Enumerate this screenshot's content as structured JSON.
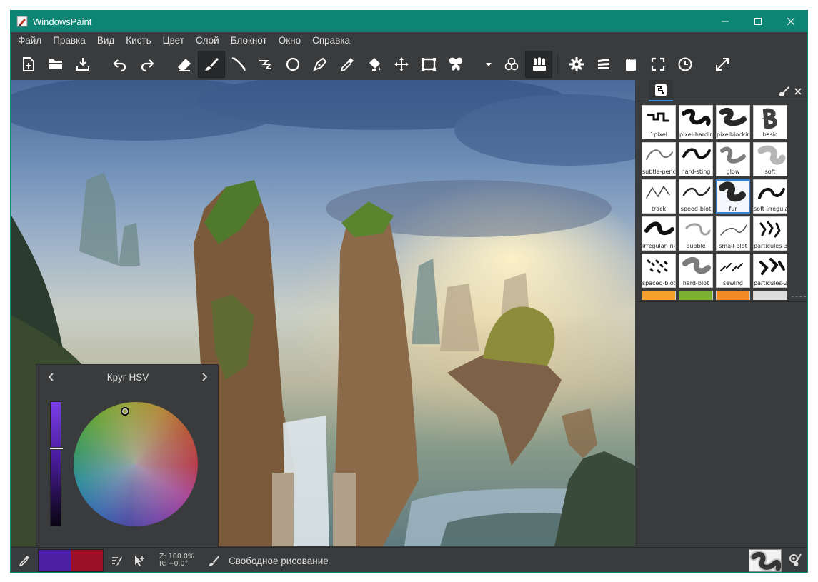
{
  "window": {
    "title": "WindowsPaint"
  },
  "menu": [
    "Файл",
    "Правка",
    "Вид",
    "Кисть",
    "Цвет",
    "Слой",
    "Блокнот",
    "Окно",
    "Справка"
  ],
  "toolbar": {
    "icons": [
      "new-document-icon",
      "open-icon",
      "save-icon",
      "undo-icon",
      "redo-icon",
      "eraser-icon",
      "brush-icon",
      "ink-icon",
      "freehand-icon",
      "ellipse-icon",
      "pen-icon",
      "color-picker-icon",
      "fill-icon",
      "move-icon",
      "frame-icon",
      "symmetry-icon",
      "dropdown-icon",
      "brush-modes-icon",
      "brush-palette-icon",
      "settings-icon",
      "layers-icon",
      "scratchpad-icon",
      "fullscreen-icon",
      "timer-icon",
      "expand-icon"
    ],
    "active": "brush-icon"
  },
  "brushes": [
    {
      "name": "1pixel"
    },
    {
      "name": "pixel-hardink"
    },
    {
      "name": "pixelblocking"
    },
    {
      "name": "basic"
    },
    {
      "name": "subtle-pencil"
    },
    {
      "name": "hard-sting"
    },
    {
      "name": "glow"
    },
    {
      "name": "soft"
    },
    {
      "name": "track"
    },
    {
      "name": "speed-blot"
    },
    {
      "name": "fur"
    },
    {
      "name": "soft-irregular"
    },
    {
      "name": "irregular-ink"
    },
    {
      "name": "bubble"
    },
    {
      "name": "small-blot"
    },
    {
      "name": "particules-3"
    },
    {
      "name": "spaced-blot"
    },
    {
      "name": "hard-blot"
    },
    {
      "name": "sewing"
    },
    {
      "name": "particules-2"
    },
    {
      "name": ""
    },
    {
      "name": ""
    },
    {
      "name": ""
    },
    {
      "name": ""
    }
  ],
  "selected_brush": "fur",
  "hsv_panel": {
    "title": "Круг HSV"
  },
  "status": {
    "zoom": "Z: 100.0%",
    "rotation": "R: +0.0°",
    "mode": "Свободное рисование"
  },
  "colors": {
    "primary": "#4b1fa0",
    "secondary": "#9b1024",
    "accent": "#0d8574"
  }
}
